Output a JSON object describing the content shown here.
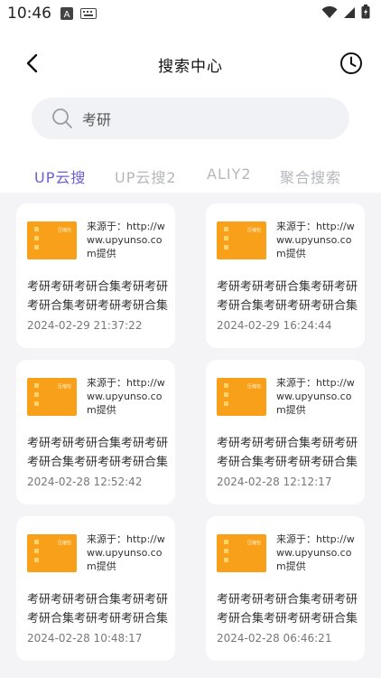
{
  "status_bar": {
    "time": "10:46"
  },
  "header": {
    "title": "搜索中心"
  },
  "search": {
    "value": "考研",
    "placeholder": ""
  },
  "tabs": [
    {
      "label": "UP云搜",
      "active": true
    },
    {
      "label": "UP云搜2",
      "active": false
    },
    {
      "label": "ALIY2",
      "active": false
    },
    {
      "label": "聚合搜索",
      "active": false
    }
  ],
  "colors": {
    "accent": "#6c5ecf",
    "thumb": "#f9a01b",
    "background": "#f4f4f7"
  },
  "results": [
    {
      "source": "来源于：http://www.upyunso.com提供",
      "title": "考研考研考研合集考研考研考研合集考研考研考研合集",
      "date": "2024-02-29 21:37:22",
      "thumb_label": "压缩包"
    },
    {
      "source": "来源于：http://www.upyunso.com提供",
      "title": "考研考研考研合集考研考研考研合集考研考研考研合集",
      "date": "2024-02-29 16:24:44",
      "thumb_label": "压缩包"
    },
    {
      "source": "来源于：http://www.upyunso.com提供",
      "title": "考研考研考研合集考研考研考研合集考研考研考研合集",
      "date": "2024-02-28 12:52:42",
      "thumb_label": "压缩包"
    },
    {
      "source": "来源于：http://www.upyunso.com提供",
      "title": "考研考研考研合集考研考研考研合集考研考研考研合集",
      "date": "2024-02-28 12:12:17",
      "thumb_label": "压缩包"
    },
    {
      "source": "来源于：http://www.upyunso.com提供",
      "title": "考研考研考研合集考研考研考研合集考研考研考研合集",
      "date": "2024-02-28 10:48:17",
      "thumb_label": "压缩包"
    },
    {
      "source": "来源于：http://www.upyunso.com提供",
      "title": "考研考研考研合集考研考研考研合集考研考研考研合集",
      "date": "2024-02-28 06:46:21",
      "thumb_label": "压缩包"
    }
  ]
}
